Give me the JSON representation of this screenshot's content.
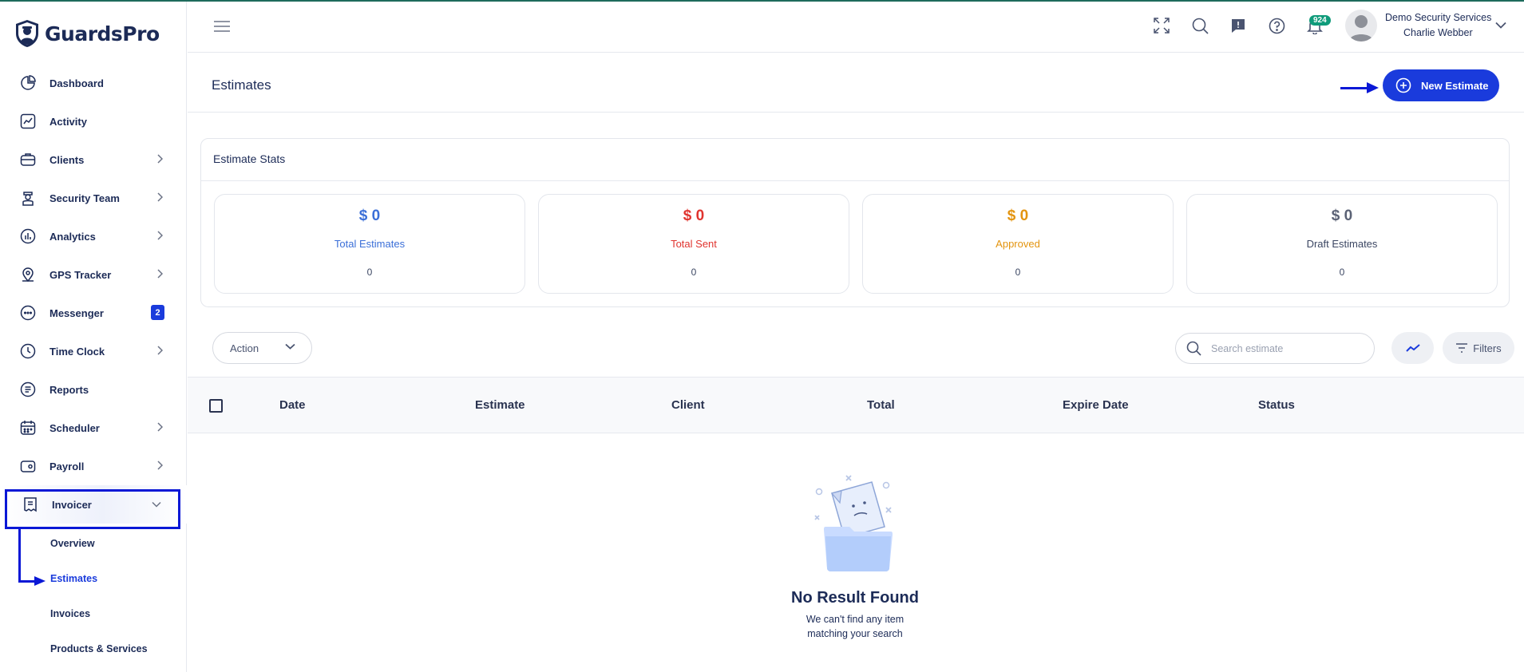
{
  "app": {
    "brand": "GuardsPro",
    "accent_color": "#1a3bdc",
    "annotation_color": "#0a18d6"
  },
  "sidebar": {
    "items": [
      {
        "label": "Dashboard",
        "icon": "pie-chart-icon",
        "has_chevron": false
      },
      {
        "label": "Activity",
        "icon": "activity-chart-icon",
        "has_chevron": false
      },
      {
        "label": "Clients",
        "icon": "briefcase-icon",
        "has_chevron": true
      },
      {
        "label": "Security Team",
        "icon": "guard-icon",
        "has_chevron": true
      },
      {
        "label": "Analytics",
        "icon": "bar-chart-icon",
        "has_chevron": true
      },
      {
        "label": "GPS Tracker",
        "icon": "map-pin-icon",
        "has_chevron": true
      },
      {
        "label": "Messenger",
        "icon": "chat-icon",
        "badge": "2"
      },
      {
        "label": "Time Clock",
        "icon": "clock-icon",
        "has_chevron": true
      },
      {
        "label": "Reports",
        "icon": "report-icon",
        "has_chevron": false
      },
      {
        "label": "Scheduler",
        "icon": "calendar-icon",
        "has_chevron": true
      },
      {
        "label": "Payroll",
        "icon": "wallet-icon",
        "has_chevron": true
      },
      {
        "label": "Invoicer",
        "icon": "invoice-icon",
        "expanded": true
      }
    ],
    "invoicer_sub": [
      {
        "label": "Overview"
      },
      {
        "label": "Estimates",
        "current": true
      },
      {
        "label": "Invoices"
      },
      {
        "label": "Products & Services"
      }
    ]
  },
  "header": {
    "notifications_count": "924",
    "company": "Demo Security Services",
    "user": "Charlie Webber"
  },
  "page": {
    "title": "Estimates",
    "new_button": "New Estimate"
  },
  "stats": {
    "title": "Estimate Stats",
    "cards": [
      {
        "amount": "$ 0",
        "label": "Total Estimates",
        "count": "0",
        "color": "#3b6fd8"
      },
      {
        "amount": "$ 0",
        "label": "Total Sent",
        "count": "0",
        "color": "#e0342f"
      },
      {
        "amount": "$ 0",
        "label": "Approved",
        "count": "0",
        "color": "#e3940f"
      },
      {
        "amount": "$ 0",
        "label": "Draft Estimates",
        "count": "0",
        "color": "#5b6275"
      }
    ]
  },
  "toolbar": {
    "action_label": "Action",
    "search_placeholder": "Search estimate",
    "filters_label": "Filters"
  },
  "table": {
    "columns": [
      "Date",
      "Estimate",
      "Client",
      "Total",
      "Expire Date",
      "Status"
    ]
  },
  "empty": {
    "title": "No Result Found",
    "line1": "We can't find any item",
    "line2": "matching your search"
  }
}
